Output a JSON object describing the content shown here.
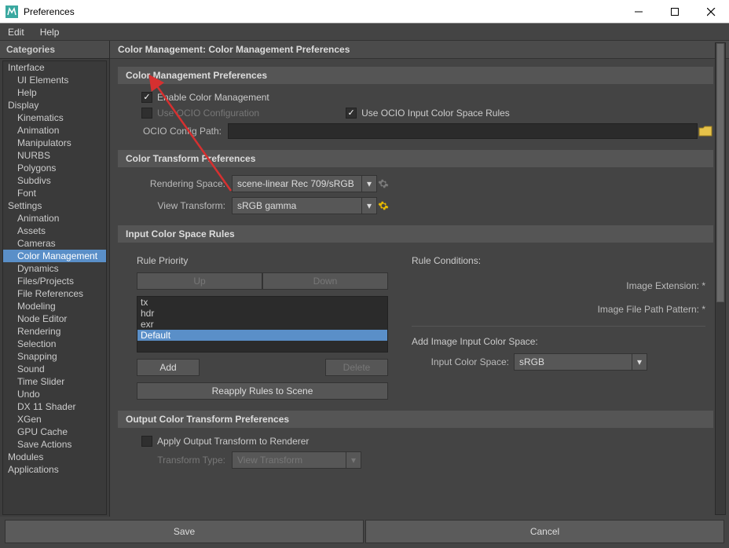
{
  "titlebar": {
    "title": "Preferences"
  },
  "menubar": {
    "edit": "Edit",
    "help": "Help"
  },
  "sidebar": {
    "header": "Categories",
    "items": [
      {
        "label": "Interface",
        "kind": "group"
      },
      {
        "label": "UI Elements",
        "kind": "item"
      },
      {
        "label": "Help",
        "kind": "item"
      },
      {
        "label": "Display",
        "kind": "group"
      },
      {
        "label": "Kinematics",
        "kind": "item"
      },
      {
        "label": "Animation",
        "kind": "item"
      },
      {
        "label": "Manipulators",
        "kind": "item"
      },
      {
        "label": "NURBS",
        "kind": "item"
      },
      {
        "label": "Polygons",
        "kind": "item"
      },
      {
        "label": "Subdivs",
        "kind": "item"
      },
      {
        "label": "Font",
        "kind": "item"
      },
      {
        "label": "Settings",
        "kind": "group"
      },
      {
        "label": "Animation",
        "kind": "item"
      },
      {
        "label": "Assets",
        "kind": "item"
      },
      {
        "label": "Cameras",
        "kind": "item"
      },
      {
        "label": "Color Management",
        "kind": "item",
        "selected": true
      },
      {
        "label": "Dynamics",
        "kind": "item"
      },
      {
        "label": "Files/Projects",
        "kind": "item"
      },
      {
        "label": "File References",
        "kind": "item"
      },
      {
        "label": "Modeling",
        "kind": "item"
      },
      {
        "label": "Node Editor",
        "kind": "item"
      },
      {
        "label": "Rendering",
        "kind": "item"
      },
      {
        "label": "Selection",
        "kind": "item"
      },
      {
        "label": "Snapping",
        "kind": "item"
      },
      {
        "label": "Sound",
        "kind": "item"
      },
      {
        "label": "Time Slider",
        "kind": "item"
      },
      {
        "label": "Undo",
        "kind": "item"
      },
      {
        "label": "DX 11 Shader",
        "kind": "item"
      },
      {
        "label": "XGen",
        "kind": "item"
      },
      {
        "label": "GPU Cache",
        "kind": "item"
      },
      {
        "label": "Save Actions",
        "kind": "item"
      },
      {
        "label": "Modules",
        "kind": "group"
      },
      {
        "label": "Applications",
        "kind": "group"
      }
    ]
  },
  "content": {
    "header": "Color Management: Color Management Preferences",
    "cm_prefs": {
      "title": "Color Management Preferences",
      "enable_label": "Enable Color Management",
      "use_ocio_label": "Use OCIO Configuration",
      "use_ocio_rules_label": "Use OCIO Input Color Space Rules",
      "config_path_label": "OCIO Config Path:",
      "config_path_value": ""
    },
    "ct_prefs": {
      "title": "Color Transform Preferences",
      "rendering_space_label": "Rendering Space:",
      "rendering_space_value": "scene-linear Rec 709/sRGB",
      "view_transform_label": "View Transform:",
      "view_transform_value": "sRGB gamma"
    },
    "input_rules": {
      "title": "Input Color Space Rules",
      "rule_priority_label": "Rule Priority",
      "up_label": "Up",
      "down_label": "Down",
      "list": [
        "tx",
        "hdr",
        "exr",
        "Default"
      ],
      "selected_index": 3,
      "add_label": "Add",
      "delete_label": "Delete",
      "reapply_label": "Reapply Rules to Scene",
      "conditions": {
        "title": "Rule Conditions:",
        "image_ext_label": "Image Extension: *",
        "pattern_label": "Image File Path Pattern: *",
        "add_space_title": "Add Image Input Color Space:",
        "input_space_label": "Input Color Space:",
        "input_space_value": "sRGB"
      }
    },
    "output_prefs": {
      "title": "Output Color Transform Preferences",
      "apply_label": "Apply Output Transform to Renderer",
      "transform_type_label": "Transform Type:",
      "transform_type_value": "View Transform"
    }
  },
  "footer": {
    "save": "Save",
    "cancel": "Cancel"
  },
  "colors": {
    "accent": "#5a8fc8",
    "gear_yellow": "#e6b800"
  }
}
